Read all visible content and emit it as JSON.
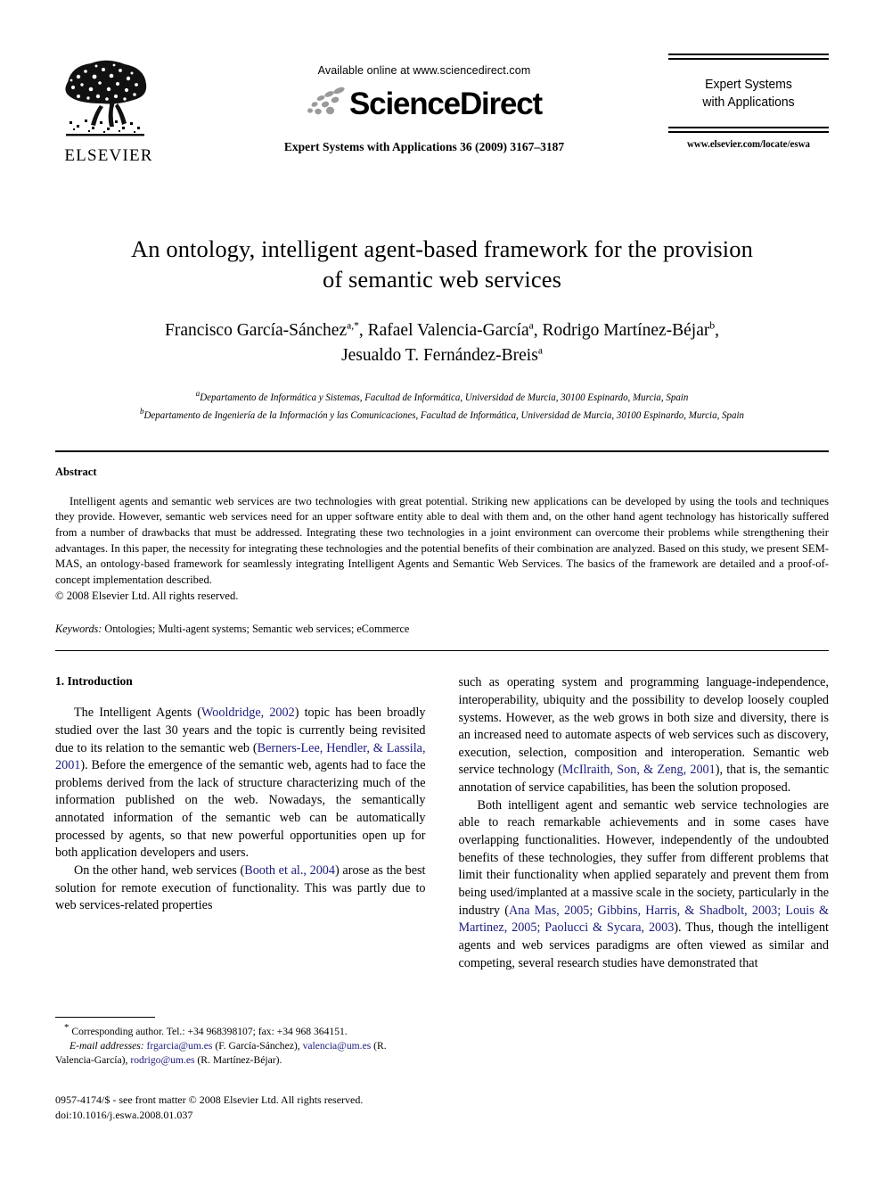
{
  "masthead": {
    "publisher_logo_word": "ELSEVIER",
    "publisher_logo_icon": "elsevier-tree-icon",
    "available_online": "Available online at www.sciencedirect.com",
    "sciencedirect_word": "ScienceDirect",
    "sciencedirect_icon": "sciencedirect-swoosh-icon",
    "journal_citation": "Expert Systems with Applications 36 (2009) 3167–3187",
    "journal_brand_line1": "Expert Systems",
    "journal_brand_line2": "with Applications",
    "journal_url": "www.elsevier.com/locate/eswa"
  },
  "title": {
    "line1": "An ontology, intelligent agent-based framework for the provision",
    "line2": "of semantic web services"
  },
  "authors": {
    "line1_pre": "Francisco García-Sánchez",
    "line1_sup1": "a,*",
    "line1_mid1": ", Rafael Valencia-García",
    "line1_sup2": "a",
    "line1_mid2": ", Rodrigo Martínez-Béjar",
    "line1_sup3": "b",
    "line1_end": ",",
    "line2_pre": "Jesualdo T. Fernández-Breis",
    "line2_sup": "a"
  },
  "affiliations": [
    {
      "marker": "a",
      "text": "Departamento de Informática y Sistemas, Facultad de Informática, Universidad de Murcia, 30100 Espinardo, Murcia, Spain"
    },
    {
      "marker": "b",
      "text": "Departamento de Ingeniería de la Información y las Comunicaciones, Facultad de Informática, Universidad de Murcia, 30100 Espinardo, Murcia, Spain"
    }
  ],
  "abstract": {
    "heading": "Abstract",
    "text": "Intelligent agents and semantic web services are two technologies with great potential. Striking new applications can be developed by using the tools and techniques they provide. However, semantic web services need for an upper software entity able to deal with them and, on the other hand agent technology has historically suffered from a number of drawbacks that must be addressed. Integrating these two technologies in a joint environment can overcome their problems while strengthening their advantages. In this paper, the necessity for integrating these technologies and the potential benefits of their combination are analyzed. Based on this study, we present SEM-MAS, an ontology-based framework for seamlessly integrating Intelligent Agents and Semantic Web Services. The basics of the framework are detailed and a proof-of-concept implementation described.",
    "copyright": "© 2008 Elsevier Ltd. All rights reserved.",
    "keywords_label": "Keywords:",
    "keywords_value": "Ontologies; Multi-agent systems; Semantic web services; eCommerce"
  },
  "introduction": {
    "heading": "1. Introduction",
    "left_paragraphs": [
      {
        "segments": [
          {
            "t": "The Intelligent Agents (",
            "cite": false
          },
          {
            "t": "Wooldridge, 2002",
            "cite": true
          },
          {
            "t": ") topic has been broadly studied over the last 30 years and the topic is currently being revisited due to its relation to the semantic web (",
            "cite": false
          },
          {
            "t": "Berners-Lee, Hendler, & Lassila, 2001",
            "cite": true
          },
          {
            "t": "). Before the emergence of the semantic web, agents had to face the problems derived from the lack of structure characterizing much of the information published on the web. Nowadays, the semantically annotated information of the semantic web can be automatically processed by agents, so that new powerful opportunities open up for both application developers and users.",
            "cite": false
          }
        ]
      },
      {
        "segments": [
          {
            "t": "On the other hand, web services (",
            "cite": false
          },
          {
            "t": "Booth et al., 2004",
            "cite": true
          },
          {
            "t": ") arose as the best solution for remote execution of functionality. This was partly due to web services-related properties",
            "cite": false
          }
        ]
      }
    ],
    "right_paragraphs": [
      {
        "indent": false,
        "segments": [
          {
            "t": "such as operating system and programming language-independence, interoperability, ubiquity and the possibility to develop loosely coupled systems. However, as the web grows in both size and diversity, there is an increased need to automate aspects of web services such as discovery, execution, selection, composition and interoperation. Semantic web service technology (",
            "cite": false
          },
          {
            "t": "McIlraith, Son, & Zeng, 2001",
            "cite": true
          },
          {
            "t": "), that is, the semantic annotation of service capabilities, has been the solution proposed.",
            "cite": false
          }
        ]
      },
      {
        "indent": true,
        "segments": [
          {
            "t": "Both intelligent agent and semantic web service technologies are able to reach remarkable achievements and in some cases have overlapping functionalities. However, independently of the undoubted benefits of these technologies, they suffer from different problems that limit their functionality when applied separately and prevent them from being used/implanted at a massive scale in the society, particularly in the industry (",
            "cite": false
          },
          {
            "t": "Ana Mas, 2005; Gibbins, Harris, & Shadbolt, 2003; Louis & Martinez, 2005; Paolucci & Sycara, 2003",
            "cite": true
          },
          {
            "t": "). Thus, though the intelligent agents and web services paradigms are often viewed as similar and competing, several research studies have demonstrated that",
            "cite": false
          }
        ]
      }
    ]
  },
  "footnote": {
    "corresponding_marker": "*",
    "corresponding_text": "Corresponding author. Tel.: +34 968398107; fax: +34 968 364151.",
    "email_label": "E-mail addresses:",
    "emails": [
      {
        "address": "frgarcia@um.es",
        "owner": "(F. García-Sánchez),"
      },
      {
        "address": "valencia@um.es",
        "owner": "(R. Valencia-García),"
      },
      {
        "address": "rodrigo@um.es",
        "owner": "(R. Martínez-Béjar)."
      }
    ],
    "issn_line": "0957-4174/$ - see front matter © 2008 Elsevier Ltd. All rights reserved.",
    "doi_line": "doi:10.1016/j.eswa.2008.01.037"
  },
  "colors": {
    "citation_link": "#1b1b7e",
    "text": "#000000",
    "sciencedirect_dots": "#9a9a9a"
  }
}
